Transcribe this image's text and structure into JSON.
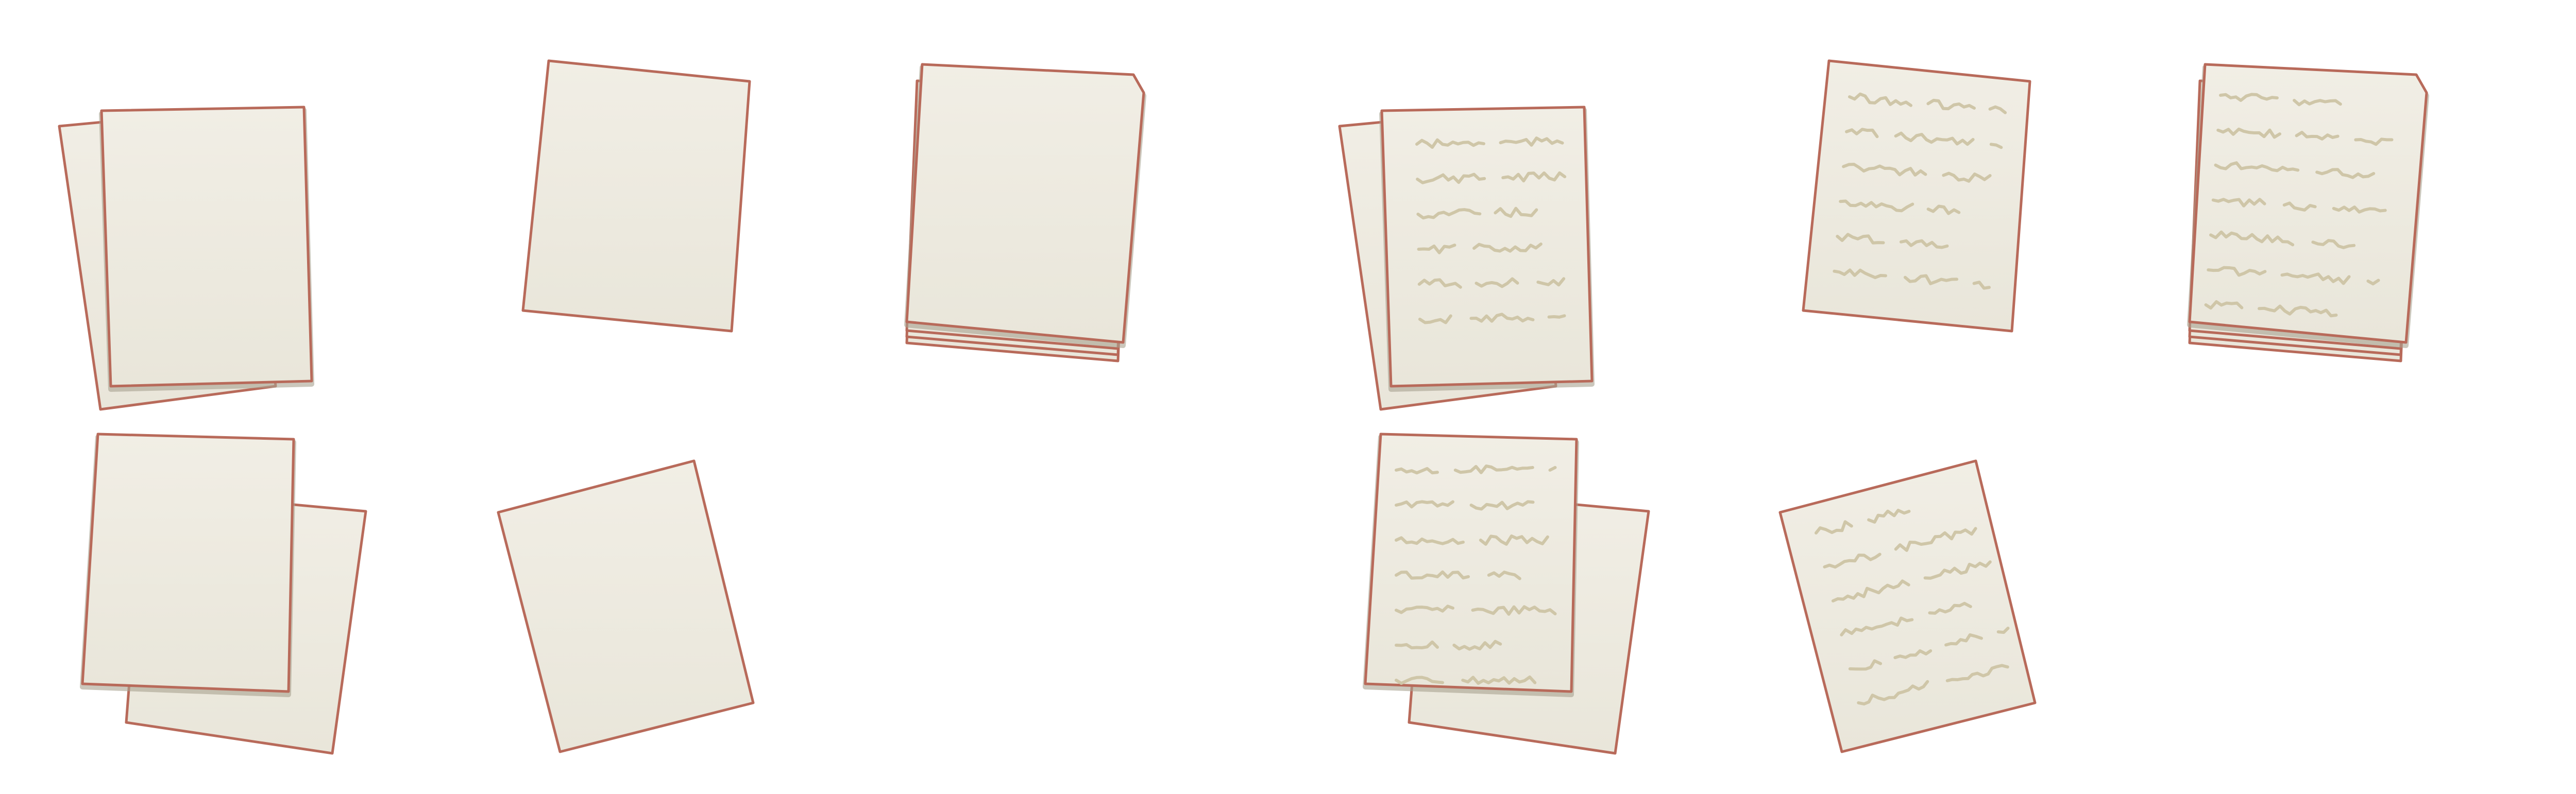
{
  "colors": {
    "background": "#ffffff",
    "paper_fill_top": "#f1eee5",
    "paper_fill_bottom": "#e9e6da",
    "paper_edge": "#b86a5a",
    "paper_shadow": "#a9a190",
    "scribble": "#cfc6a8"
  },
  "icons": [
    {
      "name": "stacked-papers-blank-icon",
      "variant": "two-sheets-fanned",
      "written": false
    },
    {
      "name": "single-paper-blank-icon",
      "variant": "single-tilted",
      "written": false
    },
    {
      "name": "paper-stack-blank-icon",
      "variant": "stack",
      "written": false
    },
    {
      "name": "stacked-papers-written-icon",
      "variant": "two-sheets-fanned",
      "written": true
    },
    {
      "name": "single-paper-written-icon",
      "variant": "single-tilted",
      "written": true
    },
    {
      "name": "paper-stack-written-icon",
      "variant": "stack",
      "written": true
    },
    {
      "name": "overlapping-papers-blank-icon",
      "variant": "two-sheets-offset",
      "written": false
    },
    {
      "name": "rotated-paper-blank-icon",
      "variant": "single-rotated",
      "written": false
    },
    {
      "name": "overlapping-papers-written-icon",
      "variant": "two-sheets-offset",
      "written": true
    },
    {
      "name": "rotated-paper-written-icon",
      "variant": "single-rotated",
      "written": true
    }
  ]
}
